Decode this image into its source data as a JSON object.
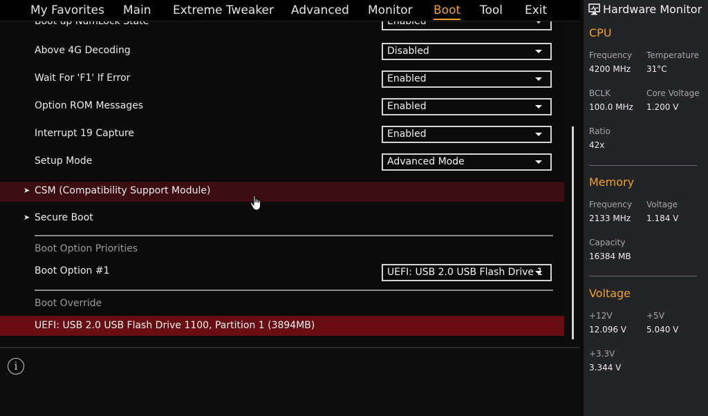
{
  "nav": {
    "items": [
      "My Favorites",
      "Main",
      "Extreme Tweaker",
      "Advanced",
      "Monitor",
      "Boot",
      "Tool",
      "Exit"
    ],
    "active": "Boot"
  },
  "settings": {
    "numlock_label": "Boot up NumLock State",
    "numlock_value": "Enabled",
    "above4g_label": "Above 4G Decoding",
    "above4g_value": "Disabled",
    "waitf1_label": "Wait For 'F1' If Error",
    "waitf1_value": "Enabled",
    "optrom_label": "Option ROM Messages",
    "optrom_value": "Enabled",
    "int19_label": "Interrupt 19 Capture",
    "int19_value": "Enabled",
    "setup_label": "Setup Mode",
    "setup_value": "Advanced Mode"
  },
  "submenus": {
    "csm": "CSM (Compatibility Support Module)",
    "secure": "Secure Boot"
  },
  "boot_priorities": {
    "title": "Boot Option Priorities",
    "option1_label": "Boot Option #1",
    "option1_value": "UEFI: USB 2.0 USB Flash Drive 1"
  },
  "boot_override": {
    "title": "Boot Override",
    "item": "UEFI: USB 2.0 USB Flash Drive 1100, Partition 1 (3894MB)"
  },
  "info_icon": "info-icon",
  "hardware_monitor": {
    "title": "Hardware Monitor",
    "cpu": {
      "title": "CPU",
      "frequency_label": "Frequency",
      "frequency_value": "4200 MHz",
      "temperature_label": "Temperature",
      "temperature_value": "31°C",
      "bclk_label": "BCLK",
      "bclk_value": "100.0 MHz",
      "core_voltage_label": "Core Voltage",
      "core_voltage_value": "1.200 V",
      "ratio_label": "Ratio",
      "ratio_value": "42x"
    },
    "memory": {
      "title": "Memory",
      "frequency_label": "Frequency",
      "frequency_value": "2133 MHz",
      "voltage_label": "Voltage",
      "voltage_value": "1.184 V",
      "capacity_label": "Capacity",
      "capacity_value": "16384 MB"
    },
    "voltage": {
      "title": "Voltage",
      "v12_label": "+12V",
      "v12_value": "12.096 V",
      "v5_label": "+5V",
      "v5_value": "5.040 V",
      "v33_label": "+3.3V",
      "v33_value": "3.344 V"
    }
  },
  "colors": {
    "accent": "#f0a12e",
    "highlight_row": "#6a0d13",
    "hover_row": "#3b0c10",
    "monitor_bg": "#222428"
  }
}
